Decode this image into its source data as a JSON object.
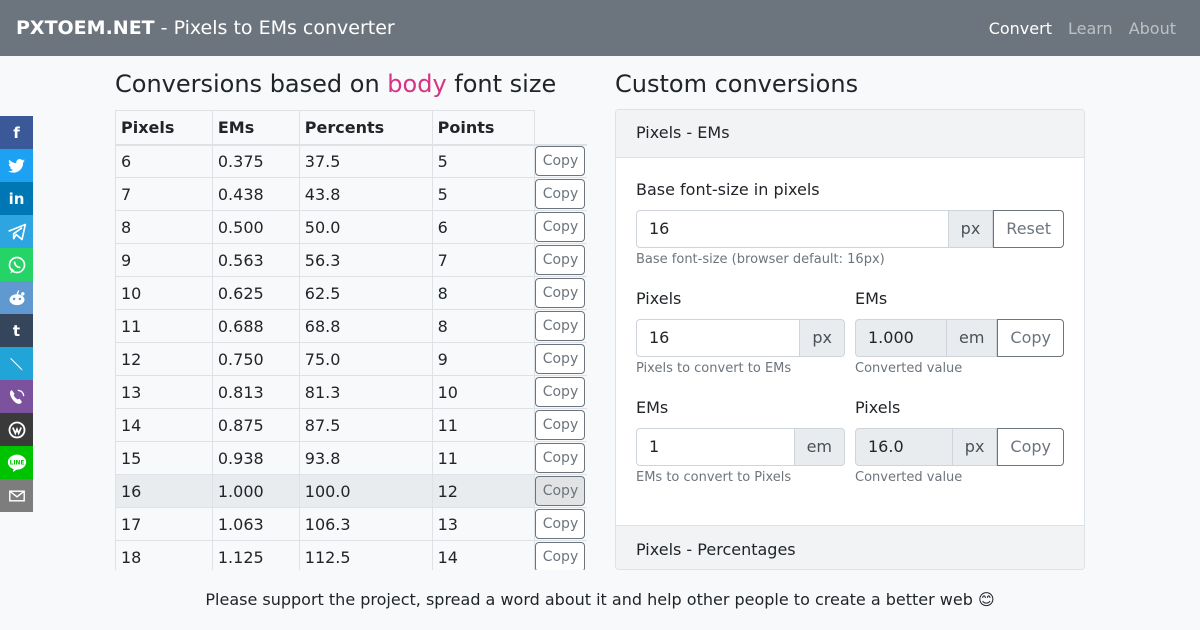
{
  "navbar": {
    "brand_bold": "PXTOEM.NET",
    "brand_rest": " - Pixels to EMs converter",
    "links": [
      "Convert",
      "Learn",
      "About"
    ]
  },
  "left": {
    "title_pre": "Conversions based on ",
    "title_kw": "body",
    "title_post": " font size",
    "columns": [
      "Pixels",
      "EMs",
      "Percents",
      "Points"
    ],
    "copy_label": "Copy",
    "rows": [
      [
        "6",
        "0.375",
        "37.5",
        "5"
      ],
      [
        "7",
        "0.438",
        "43.8",
        "5"
      ],
      [
        "8",
        "0.500",
        "50.0",
        "6"
      ],
      [
        "9",
        "0.563",
        "56.3",
        "7"
      ],
      [
        "10",
        "0.625",
        "62.5",
        "8"
      ],
      [
        "11",
        "0.688",
        "68.8",
        "8"
      ],
      [
        "12",
        "0.750",
        "75.0",
        "9"
      ],
      [
        "13",
        "0.813",
        "81.3",
        "10"
      ],
      [
        "14",
        "0.875",
        "87.5",
        "11"
      ],
      [
        "15",
        "0.938",
        "93.8",
        "11"
      ],
      [
        "16",
        "1.000",
        "100.0",
        "12"
      ],
      [
        "17",
        "1.063",
        "106.3",
        "13"
      ],
      [
        "18",
        "1.125",
        "112.5",
        "14"
      ]
    ],
    "highlighted_row": "16"
  },
  "right": {
    "title": "Custom conversions",
    "card_header": "Pixels - EMs",
    "base_label": "Base font-size in pixels",
    "base_value": "16",
    "base_unit": "px",
    "reset_label": "Reset",
    "base_help": "Base font-size (browser default: 16px)",
    "px_label": "Pixels",
    "px_value": "16",
    "px_unit": "px",
    "px_help": "Pixels to convert to EMs",
    "em_out_label": "EMs",
    "em_out_value": "1.000",
    "em_out_unit": "em",
    "em_out_help": "Converted value",
    "em_label": "EMs",
    "em_value": "1",
    "em_unit": "em",
    "em_help": "EMs to convert to Pixels",
    "px_out_label": "Pixels",
    "px_out_value": "16.0",
    "px_out_unit": "px",
    "px_out_help": "Converted value",
    "copy_label": "Copy",
    "next_header": "Pixels - Percentages"
  },
  "social": [
    {
      "name": "facebook",
      "color": "#3b5998",
      "glyph": "f"
    },
    {
      "name": "twitter",
      "color": "#1da1f2",
      "glyph": ""
    },
    {
      "name": "linkedin",
      "color": "#0077b5",
      "glyph": "in"
    },
    {
      "name": "telegram",
      "color": "#2ca5e0",
      "glyph": ""
    },
    {
      "name": "whatsapp",
      "color": "#25d366",
      "glyph": ""
    },
    {
      "name": "reddit",
      "color": "#5f99cf",
      "glyph": ""
    },
    {
      "name": "tumblr",
      "color": "#35465c",
      "glyph": "t"
    },
    {
      "name": "livejournal",
      "color": "#21a5d8",
      "glyph": ""
    },
    {
      "name": "viber",
      "color": "#7c529e",
      "glyph": ""
    },
    {
      "name": "workplace",
      "color": "#3a3a3a",
      "glyph": ""
    },
    {
      "name": "line",
      "color": "#00c300",
      "glyph": "LINE"
    },
    {
      "name": "email",
      "color": "#7d7d7d",
      "glyph": ""
    }
  ],
  "footer": "Please support the project, spread a word about it and help other people to create a better web 😊"
}
